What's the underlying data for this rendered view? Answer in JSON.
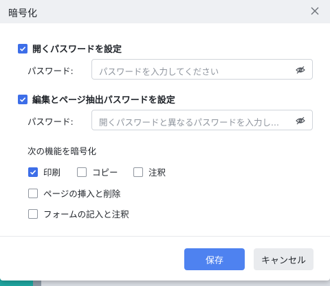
{
  "dialog": {
    "title": "暗号化",
    "open_password": {
      "checkbox_label": "開くパスワードを設定",
      "checked": true,
      "field_label": "パスワード:",
      "placeholder": "パスワードを入力してください"
    },
    "edit_password": {
      "checkbox_label": "編集とページ抽出パスワードを設定",
      "checked": true,
      "field_label": "パスワード:",
      "placeholder": "開くパスワードと異なるパスワードを入力し..."
    },
    "encrypt_section": {
      "title": "次の機能を暗号化",
      "options": [
        {
          "label": "印刷",
          "checked": true
        },
        {
          "label": "コピー",
          "checked": false
        },
        {
          "label": "注釈",
          "checked": false
        },
        {
          "label": "ページの挿入と削除",
          "checked": false
        },
        {
          "label": "フォームの記入と注釈",
          "checked": false
        }
      ]
    },
    "buttons": {
      "save": "保存",
      "cancel": "キャンセル"
    },
    "colors": {
      "accent": "#3d6ee8",
      "primary_button": "#4e82f0",
      "titlebar": "#eef0f3"
    },
    "icons": {
      "close": "close-icon",
      "eye": "eye-off-icon",
      "check": "checkmark-icon"
    }
  }
}
